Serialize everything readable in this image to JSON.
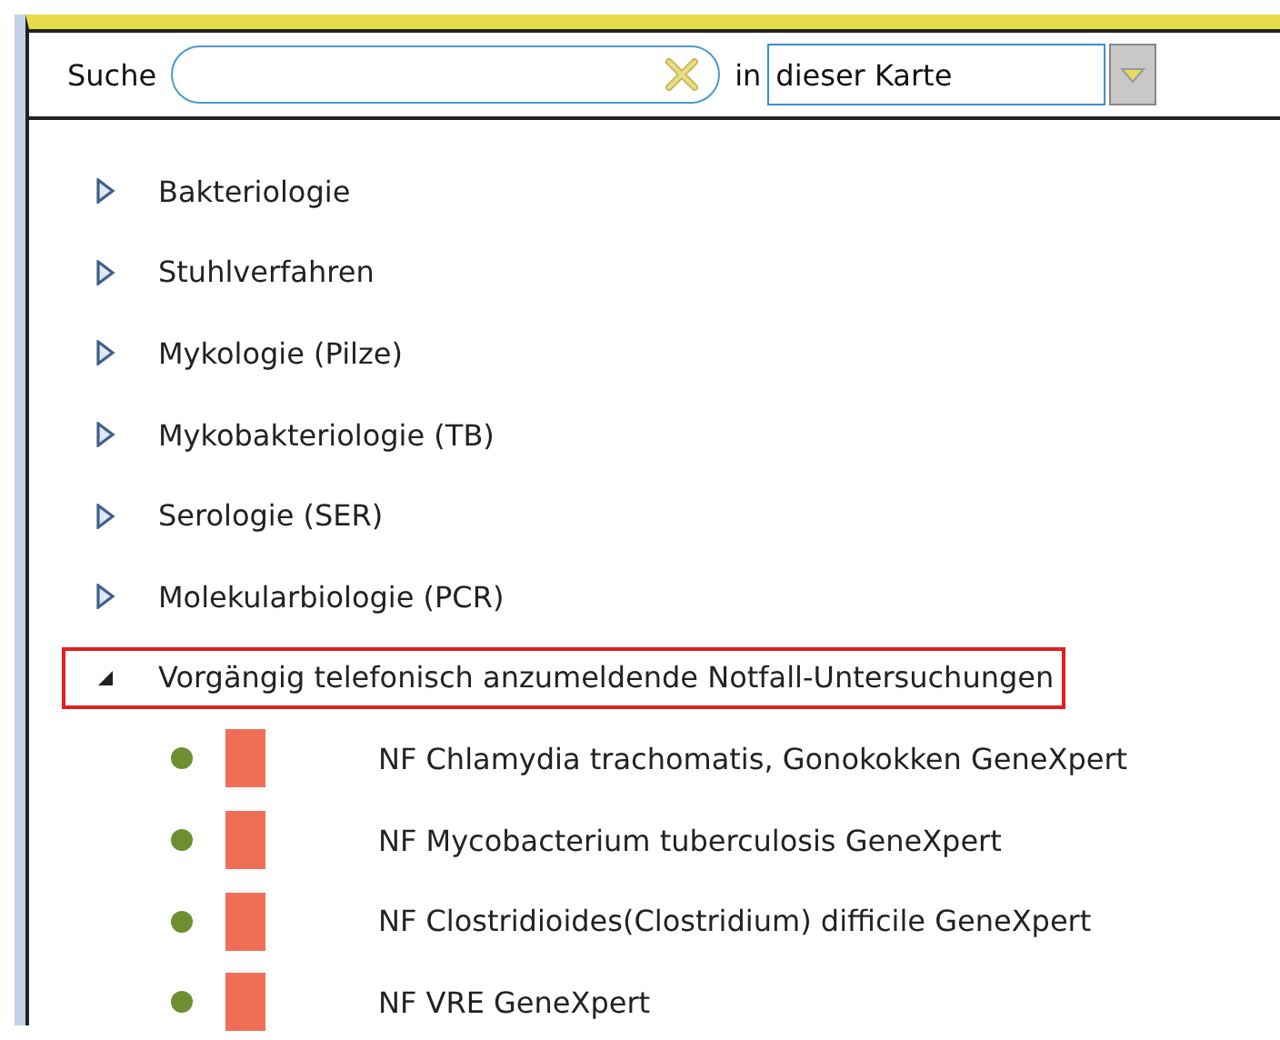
{
  "search": {
    "label": "Suche",
    "scope_label": "in",
    "scope_value": "dieser Karte"
  },
  "tree": [
    {
      "label": "Bakteriologie",
      "expanded": false,
      "selected": false
    },
    {
      "label": "Stuhlverfahren",
      "expanded": false,
      "selected": false
    },
    {
      "label": "Mykologie (Pilze)",
      "expanded": false,
      "selected": false
    },
    {
      "label": "Mykobakteriologie (TB)",
      "expanded": false,
      "selected": false
    },
    {
      "label": "Serologie (SER)",
      "expanded": false,
      "selected": false
    },
    {
      "label": "Molekularbiologie (PCR)",
      "expanded": false,
      "selected": false
    },
    {
      "label": "Vorgängig telefonisch anzumeldende Notfall-Untersuchungen",
      "expanded": true,
      "selected": true,
      "children": [
        {
          "label": "NF Chlamydia trachomatis, Gonokokken GeneXpert"
        },
        {
          "label": "NF Mycobacterium tuberculosis GeneXpert"
        },
        {
          "label": "NF Clostridioides(Clostridium) difficile GeneXpert"
        },
        {
          "label": "NF VRE GeneXpert"
        }
      ]
    }
  ]
}
